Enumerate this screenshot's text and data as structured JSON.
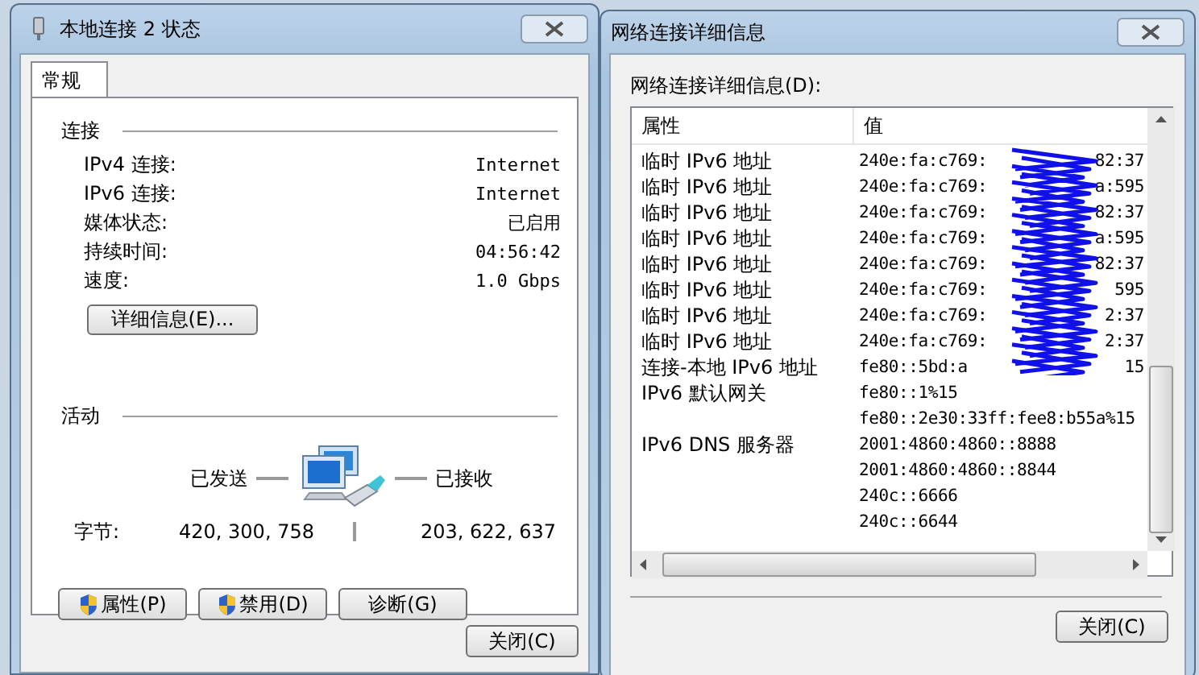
{
  "status_window": {
    "title": "本地连接 2 状态",
    "tabs": [
      {
        "label": "常规",
        "selected": true
      }
    ],
    "connection": {
      "heading": "连接",
      "rows": [
        {
          "label": "IPv4 连接:",
          "value": "Internet"
        },
        {
          "label": "IPv6 连接:",
          "value": "Internet"
        },
        {
          "label": "媒体状态:",
          "value": "已启用"
        },
        {
          "label": "持续时间:",
          "value": "04:56:42"
        },
        {
          "label": "速度:",
          "value": "1.0 Gbps"
        }
      ]
    },
    "details_button": "详细信息(E)...",
    "activity": {
      "heading": "活动",
      "sent_label": "已发送",
      "received_label": "已接收",
      "bytes_label": "字节:",
      "sent": "420, 300, 758",
      "received": "203, 622, 637"
    },
    "buttons": [
      {
        "label": "属性(P)",
        "shield": true
      },
      {
        "label": "禁用(D)",
        "shield": true
      },
      {
        "label": "诊断(G)",
        "shield": false
      }
    ],
    "close_button": "关闭(C)"
  },
  "details_window": {
    "title": "网络连接详细信息",
    "list_label": "网络连接详细信息(D):",
    "columns": [
      "属性",
      "值"
    ],
    "rows": [
      {
        "property": "临时 IPv6 地址",
        "value": "240e:fa:c769:",
        "value_end": "82:37"
      },
      {
        "property": "临时 IPv6 地址",
        "value": "240e:fa:c769:",
        "value_end": "a:595"
      },
      {
        "property": "临时 IPv6 地址",
        "value": "240e:fa:c769:",
        "value_end": "82:37"
      },
      {
        "property": "临时 IPv6 地址",
        "value": "240e:fa:c769:",
        "value_end": "a:595"
      },
      {
        "property": "临时 IPv6 地址",
        "value": "240e:fa:c769:",
        "value_end": "82:37"
      },
      {
        "property": "临时 IPv6 地址",
        "value": "240e:fa:c769:",
        "value_end": "595"
      },
      {
        "property": "临时 IPv6 地址",
        "value": "240e:fa:c769:",
        "value_end": "2:37"
      },
      {
        "property": "临时 IPv6 地址",
        "value": "240e:fa:c769:",
        "value_end": "2:37"
      },
      {
        "property": "连接-本地 IPv6 地址",
        "value": "fe80::5bd:a",
        "value_end": "15"
      },
      {
        "property": "IPv6 默认网关",
        "value": "fe80::1%15"
      },
      {
        "value": "fe80::2e30:33ff:fee8:b55a%15"
      },
      {
        "property": "IPv6 DNS 服务器",
        "value": "2001:4860:4860::8888"
      },
      {
        "value": "2001:4860:4860::8844"
      },
      {
        "value": "240c::6666"
      },
      {
        "value": "240c::6644"
      }
    ],
    "close_button": "关闭(C)"
  }
}
